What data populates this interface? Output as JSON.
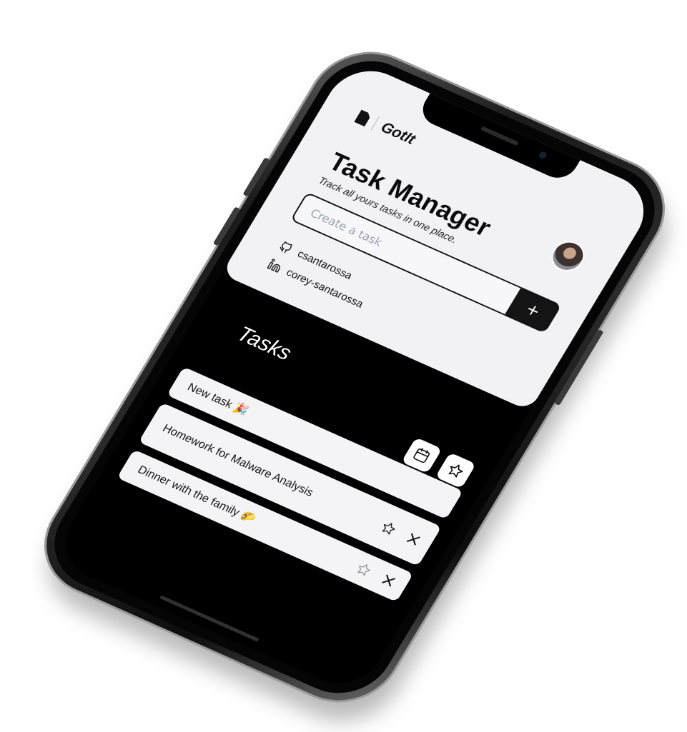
{
  "app": {
    "brand_name": "GotIt",
    "title": "Task Manager",
    "subtitle": "Track all yours tasks in one place."
  },
  "form": {
    "placeholder": "Create a task",
    "value": "",
    "add_label": "+"
  },
  "social": {
    "github_username": "csantarossa",
    "linkedin_username": "corey-santarossa"
  },
  "tasks": {
    "heading": "Tasks",
    "filters": [
      {
        "icon": "calendar-icon"
      },
      {
        "icon": "star-icon"
      }
    ],
    "items": [
      {
        "text": "New task 🎉",
        "starred": false
      },
      {
        "text": "Homework for Malware Analysis",
        "starred": false
      },
      {
        "text": "Dinner with the family 🌮",
        "starred": false
      }
    ]
  },
  "colors": {
    "background": "#000000",
    "header_background": "#f2f2f4",
    "card_background": "#f4f4f6",
    "accent": "#141414",
    "placeholder": "#9aa3b2"
  }
}
